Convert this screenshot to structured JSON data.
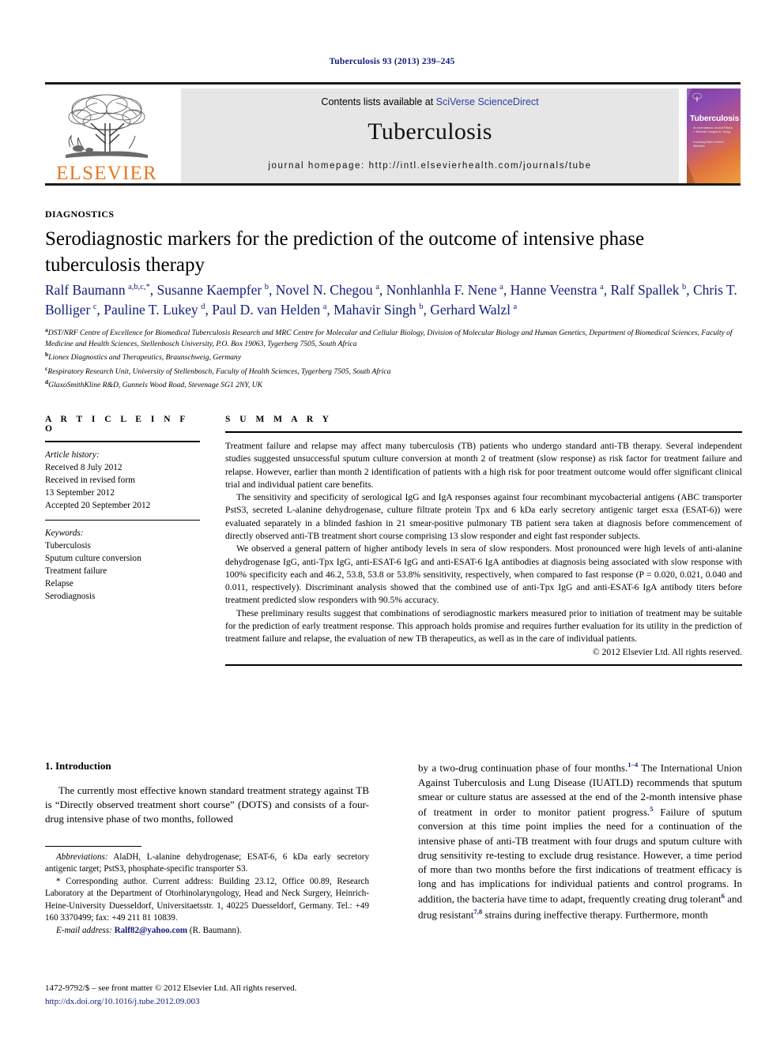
{
  "running_head": "Tuberculosis 93 (2013) 239–245",
  "masthead": {
    "publisher_logo_label": "ELSEVIER",
    "contents_prefix": "Contents lists available at ",
    "contents_link": "SciVerse ScienceDirect",
    "journal_name": "Tuberculosis",
    "homepage_label": "journal homepage: http://intl.elsevierhealth.com/journals/tube",
    "cover": {
      "title": "Tuberculosis",
      "editors_line": "An International Journal\nPatrick J. Brennan\nDouglas B. Young",
      "assoc_line": "Founding Editor\nDenis A. Mitchison"
    }
  },
  "article": {
    "kicker": "DIAGNOSTICS",
    "title": "Serodiagnostic markers for the prediction of the outcome of intensive phase tuberculosis therapy",
    "authors_html": "Ralf Baumann <sup>a,b,c,</sup><sup>*</sup>, Susanne Kaempfer <sup>b</sup>, Novel N. Chegou <sup>a</sup>, Nonhlanhla F. Nene <sup>a</sup>, Hanne Veenstra <sup>a</sup>, Ralf Spallek <sup>b</sup>, Chris T. Bolliger <sup>c</sup>, Pauline T. Lukey <sup>d</sup>, Paul D. van Helden <sup>a</sup>, Mahavir Singh <sup>b</sup>, Gerhard Walzl <sup>a</sup>",
    "affiliations": [
      {
        "mark": "a",
        "text": "DST/NRF Centre of Excellence for Biomedical Tuberculosis Research and MRC Centre for Molecular and Cellular Biology, Division of Molecular Biology and Human Genetics, Department of Biomedical Sciences, Faculty of Medicine and Health Sciences, Stellenbosch University, P.O. Box 19063, Tygerberg 7505, South Africa"
      },
      {
        "mark": "b",
        "text": "Lionex Diagnostics and Therapeutics, Braunschweig, Germany"
      },
      {
        "mark": "c",
        "text": "Respiratory Research Unit, University of Stellenbosch, Faculty of Health Sciences, Tygerberg 7505, South Africa"
      },
      {
        "mark": "d",
        "text": "GlaxoSmithKline R&D, Gunnels Wood Road, Stevenage SG1 2NY, UK"
      }
    ]
  },
  "article_info": {
    "heading": "A R T I C L E  I N F O",
    "history_label": "Article history:",
    "history": [
      "Received 8 July 2012",
      "Received in revised form",
      "13 September 2012",
      "Accepted 20 September 2012"
    ],
    "keywords_label": "Keywords:",
    "keywords": [
      "Tuberculosis",
      "Sputum culture conversion",
      "Treatment failure",
      "Relapse",
      "Serodiagnosis"
    ]
  },
  "summary": {
    "heading": "S U M M A R Y",
    "paragraphs": [
      "Treatment failure and relapse may affect many tuberculosis (TB) patients who undergo standard anti-TB therapy. Several independent studies suggested unsuccessful sputum culture conversion at month 2 of treatment (slow response) as risk factor for treatment failure and relapse. However, earlier than month 2 identification of patients with a high risk for poor treatment outcome would offer significant clinical trial and individual patient care benefits.",
      "The sensitivity and specificity of serological IgG and IgA responses against four recombinant mycobacterial antigens (ABC transporter PstS3, secreted L-alanine dehydrogenase, culture filtrate protein Tpx and 6 kDa early secretory antigenic target esxa (ESAT-6)) were evaluated separately in a blinded fashion in 21 smear-positive pulmonary TB patient sera taken at diagnosis before commencement of directly observed anti-TB treatment short course comprising 13 slow responder and eight fast responder subjects.",
      "We observed a general pattern of higher antibody levels in sera of slow responders. Most pronounced were high levels of anti-alanine dehydrogenase IgG, anti-Tpx IgG, anti-ESAT-6 IgG and anti-ESAT-6 IgA antibodies at diagnosis being associated with slow response with 100% specificity each and 46.2, 53.8, 53.8 or 53.8% sensitivity, respectively, when compared to fast response (P = 0.020, 0.021, 0.040 and 0.011, respectively). Discriminant analysis showed that the combined use of anti-Tpx IgG and anti-ESAT-6 IgA antibody titers before treatment predicted slow responders with 90.5% accuracy.",
      "These preliminary results suggest that combinations of serodiagnostic markers measured prior to initiation of treatment may be suitable for the prediction of early treatment response. This approach holds promise and requires further evaluation for its utility in the prediction of treatment failure and relapse, the evaluation of new TB therapeutics, as well as in the care of individual patients."
    ],
    "copyright": "© 2012 Elsevier Ltd. All rights reserved."
  },
  "body": {
    "intro_heading": "1.  Introduction",
    "left_paragraph": "The currently most effective known standard treatment strategy against TB is “Directly observed treatment short course” (DOTS) and consists of a four-drug intensive phase of two months, followed",
    "right_paragraph_html": "by a two-drug continuation phase of four months.<sup class=\"ref\">1–4</sup> The International Union Against Tuberculosis and Lung Disease (IUATLD) recommends that sputum smear or culture status are assessed at the end of the 2-month intensive phase of treatment in order to monitor patient progress.<sup class=\"ref\">5</sup> Failure of sputum conversion at this time point implies the need for a continuation of the intensive phase of anti-TB treatment with four drugs and sputum culture with drug sensitivity re-testing to exclude drug resistance. However, a time period of more than two months before the first indications of treatment efficacy is long and has implications for individual patients and control programs. In addition, the bacteria have time to adapt, frequently creating drug tolerant<sup class=\"ref\">6</sup> and drug resistant<sup class=\"ref\">7,8</sup> strains during ineffective therapy. Furthermore, month"
  },
  "footnotes": {
    "abbreviations_label": "Abbreviations:",
    "abbreviations_text": " AlaDH, L-alanine dehydrogenase; ESAT-6, 6 kDa early secretory antigenic target; PstS3, phosphate-specific transporter S3.",
    "corresponding_text": "* Corresponding author. Current address: Building 23.12, Office 00.89, Research Laboratory at the Department of Otorhinolaryngology, Head and Neck Surgery, Heinrich-Heine-University Duesseldorf, Universitaetsstr. 1, 40225 Duesseldorf, Germany. Tel.: +49 160 3370499; fax: +49 211 81 10839.",
    "email_label": "E-mail address:",
    "email": "Ralf82@yahoo.com",
    "email_suffix": " (R. Baumann)."
  },
  "page_footer": {
    "issn_line": "1472-9792/$ – see front matter © 2012 Elsevier Ltd. All rights reserved.",
    "doi_line": "http://dx.doi.org/10.1016/j.tube.2012.09.003"
  },
  "colors": {
    "link_blue": "#13207a",
    "sciencedirect_blue": "#2b3fa0",
    "elsevier_orange": "#e87722",
    "panel_grey": "#e6e6e6"
  }
}
